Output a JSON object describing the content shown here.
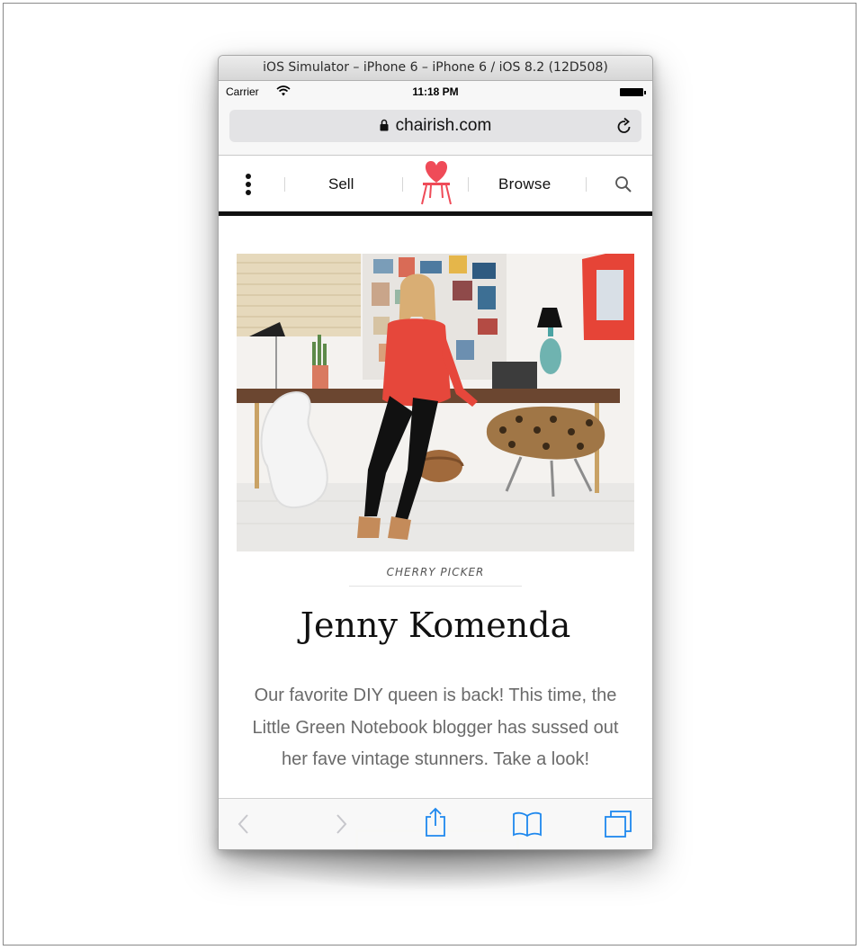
{
  "window": {
    "title": "iOS Simulator – iPhone 6 – iPhone 6 / iOS 8.2 (12D508)"
  },
  "status_bar": {
    "carrier": "Carrier",
    "time": "11:18 PM"
  },
  "address_bar": {
    "url": "chairish.com"
  },
  "site_nav": {
    "sell_label": "Sell",
    "browse_label": "Browse",
    "logo_color": "#ef4b58"
  },
  "article": {
    "eyebrow": "CHERRY PICKER",
    "title": "Jenny Komenda",
    "description": "Our favorite DIY queen is back! This time, the Little Green Notebook blogger has sussed out her fave vintage stunners. Take a look!"
  },
  "toolbar": {
    "icons": [
      "back-icon",
      "forward-icon",
      "share-icon",
      "bookmarks-icon",
      "tabs-icon"
    ],
    "tint_color": "#1e88ee",
    "disabled_color": "#c7c7cc"
  }
}
